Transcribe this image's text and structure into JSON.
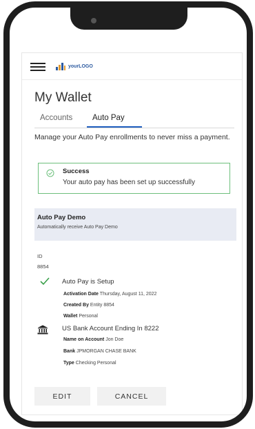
{
  "header": {
    "logo_text": "yourLOGO"
  },
  "page": {
    "title": "My Wallet"
  },
  "tabs": [
    {
      "label": "Accounts"
    },
    {
      "label": "Auto Pay"
    }
  ],
  "intro_text": "Manage your Auto Pay enrollments to never miss a payment.",
  "alert": {
    "title": "Success",
    "message": "Your auto pay has been set up successfully"
  },
  "autopay": {
    "title": "Auto Pay Demo",
    "subtitle": "Automatically receive Auto Pay Demo"
  },
  "record": {
    "id_label": "ID",
    "id_value": "8854",
    "status": "Auto Pay is Setup",
    "activation_label": "Activation Date",
    "activation_value": "Thursday, August 11, 2022",
    "created_label": "Created By",
    "created_value": "Entity 8854",
    "wallet_label": "Wallet",
    "wallet_value": "Personal",
    "bank_line": "US Bank Account Ending In 8222",
    "name_label": "Name on Account",
    "name_value": "Jon Doe",
    "bank_label": "Bank",
    "bank_value": "JPMORGAN CHASE BANK",
    "type_label": "Type",
    "type_value": "Checking Personal"
  },
  "buttons": {
    "edit": "EDIT",
    "cancel": "CANCEL"
  },
  "colors": {
    "accent": "#1f5fbf",
    "success_border": "#6cbf7b",
    "check": "#3aa04a",
    "panel_bg": "#e8ebf3"
  }
}
